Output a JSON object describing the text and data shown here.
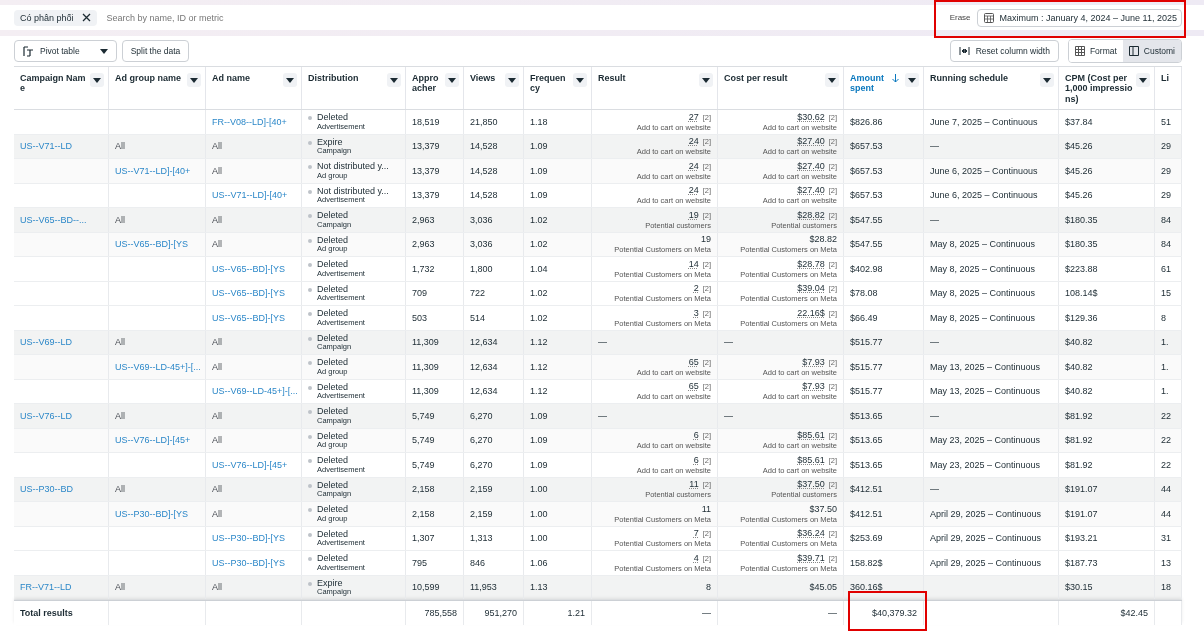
{
  "filter_bar": {
    "chips": [
      {
        "label": "Có phân phối"
      }
    ],
    "search": {
      "placeholder": "Search by name, ID or metric"
    },
    "erase": "Erase",
    "date_range": {
      "label": "Maximum : January 4, 2024 – June 11, 2025",
      "highlighted": true
    }
  },
  "toolbar": {
    "pivot": "Pivot table",
    "split": "Split the data",
    "reset": "Reset column width",
    "view_toggle": [
      {
        "label": "Format",
        "selected": false
      },
      {
        "label": "Customi",
        "selected": true
      }
    ]
  },
  "table": {
    "columns": [
      {
        "label": "Campaign Name",
        "sorted": false
      },
      {
        "label": "Ad group name",
        "sorted": false
      },
      {
        "label": "Ad name",
        "sorted": false
      },
      {
        "label": "Distribution",
        "sorted": false
      },
      {
        "label": "Approacher",
        "sorted": false
      },
      {
        "label": "Views",
        "sorted": false
      },
      {
        "label": "Frequency",
        "sorted": false
      },
      {
        "label": "Result",
        "sorted": false
      },
      {
        "label": "Cost per result",
        "sorted": false
      },
      {
        "label": "Amount spent",
        "sorted": true
      },
      {
        "label": "Running schedule",
        "sorted": false
      },
      {
        "label": "CPM (Cost per 1,000 impressions)",
        "sorted": false
      },
      {
        "label": "Li",
        "sorted": false
      }
    ],
    "rows": [
      {
        "kind": "ad",
        "ad_name": "FR--V08--LD]-[40+",
        "status": "Deleted",
        "status_scope": "Advertisement",
        "reach": "18,519",
        "views": "21,850",
        "frequency": "1.18",
        "result": {
          "value": "27",
          "note": "[2]",
          "label": "Add to cart on website"
        },
        "cost": {
          "value": "$30.62",
          "note": "[2]",
          "label": "Add to cart on website"
        },
        "spent": "$826.86",
        "schedule": "June 7, 2025 – Continuous",
        "cpm": "$37.84",
        "column_13": "51"
      },
      {
        "kind": "campaign",
        "campaign_name": "US--V71--LD",
        "ad_group_name": "All",
        "ad_name": "All",
        "status": "Expire",
        "status_scope": "Campaign",
        "reach": "13,379",
        "views": "14,528",
        "frequency": "1.09",
        "result": {
          "value": "24",
          "note": "[2]",
          "label": "Add to cart on website"
        },
        "cost": {
          "value": "$27.40",
          "note": "[2]",
          "label": "Add to cart on website"
        },
        "spent": "$657.53",
        "schedule": "—",
        "cpm": "$45.26",
        "column_13": "29"
      },
      {
        "kind": "ad_group",
        "ad_group_name": "US--V71--LD]-[40+",
        "ad_name": "All",
        "status": "Not distributed y...",
        "status_scope": "Ad group",
        "reach": "13,379",
        "views": "14,528",
        "frequency": "1.09",
        "result": {
          "value": "24",
          "note": "[2]",
          "label": "Add to cart on website"
        },
        "cost": {
          "value": "$27.40",
          "note": "[2]",
          "label": "Add to cart on website"
        },
        "spent": "$657.53",
        "schedule": "June 6, 2025 – Continuous",
        "cpm": "$45.26",
        "column_13": "29"
      },
      {
        "kind": "ad",
        "ad_name": "US--V71--LD]-[40+",
        "status": "Not distributed y...",
        "status_scope": "Advertisement",
        "reach": "13,379",
        "views": "14,528",
        "frequency": "1.09",
        "result": {
          "value": "24",
          "note": "[2]",
          "label": "Add to cart on website"
        },
        "cost": {
          "value": "$27.40",
          "note": "[2]",
          "label": "Add to cart on website"
        },
        "spent": "$657.53",
        "schedule": "June 6, 2025 – Continuous",
        "cpm": "$45.26",
        "column_13": "29"
      },
      {
        "kind": "campaign",
        "campaign_name": "US--V65--BD--...",
        "ad_group_name": "All",
        "ad_name": "All",
        "status": "Deleted",
        "status_scope": "Campaign",
        "reach": "2,963",
        "views": "3,036",
        "frequency": "1.02",
        "result": {
          "value": "19",
          "note": "[2]",
          "label": "Potential customers"
        },
        "cost": {
          "value": "$28.82",
          "note": "[2]",
          "label": "Potential customers"
        },
        "spent": "$547.55",
        "schedule": "—",
        "cpm": "$180.35",
        "column_13": "84"
      },
      {
        "kind": "ad_group",
        "ad_group_name": "US--V65--BD]-[YS",
        "ad_name": "All",
        "status": "Deleted",
        "status_scope": "Ad group",
        "reach": "2,963",
        "views": "3,036",
        "frequency": "1.02",
        "result": {
          "value": "19",
          "label": "Potential Customers on Meta"
        },
        "cost": {
          "value": "$28.82",
          "label": "Potential Customers on Meta"
        },
        "spent": "$547.55",
        "schedule": "May 8, 2025 – Continuous",
        "cpm": "$180.35",
        "column_13": "84"
      },
      {
        "kind": "ad",
        "ad_name": "US--V65--BD]-[YS",
        "status": "Deleted",
        "status_scope": "Advertisement",
        "reach": "1,732",
        "views": "1,800",
        "frequency": "1.04",
        "result": {
          "value": "14",
          "note": "[2]",
          "label": "Potential Customers on Meta"
        },
        "cost": {
          "value": "$28.78",
          "note": "[2]",
          "label": "Potential Customers on Meta"
        },
        "spent": "$402.98",
        "schedule": "May 8, 2025 – Continuous",
        "cpm": "$223.88",
        "column_13": "61"
      },
      {
        "kind": "ad",
        "ad_name": "US--V65--BD]-[YS",
        "status": "Deleted",
        "status_scope": "Advertisement",
        "reach": "709",
        "views": "722",
        "frequency": "1.02",
        "result": {
          "value": "2",
          "note": "[2]",
          "label": "Potential Customers on Meta"
        },
        "cost": {
          "value": "$39.04",
          "note": "[2]",
          "label": "Potential Customers on Meta"
        },
        "spent": "$78.08",
        "schedule": "May 8, 2025 – Continuous",
        "cpm": "108.14$",
        "column_13": "15"
      },
      {
        "kind": "ad",
        "ad_name": "US--V65--BD]-[YS",
        "status": "Deleted",
        "status_scope": "Advertisement",
        "reach": "503",
        "views": "514",
        "frequency": "1.02",
        "result": {
          "value": "3",
          "note": "[2]",
          "label": "Potential Customers on Meta"
        },
        "cost": {
          "value": "22.16$",
          "note": "[2]",
          "label": "Potential Customers on Meta"
        },
        "spent": "$66.49",
        "schedule": "May 8, 2025 – Continuous",
        "cpm": "$129.36",
        "column_13": "8"
      },
      {
        "kind": "campaign",
        "campaign_name": "US--V69--LD",
        "ad_group_name": "All",
        "ad_name": "All",
        "status": "Deleted",
        "status_scope": "Campaign",
        "reach": "11,309",
        "views": "12,634",
        "frequency": "1.12",
        "result": {
          "value": "—"
        },
        "cost": {
          "value": "—"
        },
        "spent": "$515.77",
        "schedule": "—",
        "cpm": "$40.82",
        "column_13": "1."
      },
      {
        "kind": "ad_group",
        "ad_group_name": "US--V69--LD-45+]-[...",
        "ad_name": "All",
        "status": "Deleted",
        "status_scope": "Ad group",
        "reach": "11,309",
        "views": "12,634",
        "frequency": "1.12",
        "result": {
          "value": "65",
          "note": "[2]",
          "label": "Add to cart on website"
        },
        "cost": {
          "value": "$7.93",
          "note": "[2]",
          "label": "Add to cart on website"
        },
        "spent": "$515.77",
        "schedule": "May 13, 2025 – Continuous",
        "cpm": "$40.82",
        "column_13": "1."
      },
      {
        "kind": "ad",
        "ad_name": "US--V69--LD-45+]-[...",
        "status": "Deleted",
        "status_scope": "Advertisement",
        "reach": "11,309",
        "views": "12,634",
        "frequency": "1.12",
        "result": {
          "value": "65",
          "note": "[2]",
          "label": "Add to cart on website"
        },
        "cost": {
          "value": "$7.93",
          "note": "[2]",
          "label": "Add to cart on website"
        },
        "spent": "$515.77",
        "schedule": "May 13, 2025 – Continuous",
        "cpm": "$40.82",
        "column_13": "1."
      },
      {
        "kind": "campaign",
        "campaign_name": "US--V76--LD",
        "ad_group_name": "All",
        "ad_name": "All",
        "status": "Deleted",
        "status_scope": "Campaign",
        "reach": "5,749",
        "views": "6,270",
        "frequency": "1.09",
        "result": {
          "value": "—"
        },
        "cost": {
          "value": "—"
        },
        "spent": "$513.65",
        "schedule": "—",
        "cpm": "$81.92",
        "column_13": "22"
      },
      {
        "kind": "ad_group",
        "ad_group_name": "US--V76--LD]-[45+",
        "ad_name": "All",
        "status": "Deleted",
        "status_scope": "Ad group",
        "reach": "5,749",
        "views": "6,270",
        "frequency": "1.09",
        "result": {
          "value": "6",
          "note": "[2]",
          "label": "Add to cart on website"
        },
        "cost": {
          "value": "$85.61",
          "note": "[2]",
          "label": "Add to cart on website"
        },
        "spent": "$513.65",
        "schedule": "May 23, 2025 – Continuous",
        "cpm": "$81.92",
        "column_13": "22"
      },
      {
        "kind": "ad",
        "ad_name": "US--V76--LD]-[45+",
        "status": "Deleted",
        "status_scope": "Advertisement",
        "reach": "5,749",
        "views": "6,270",
        "frequency": "1.09",
        "result": {
          "value": "6",
          "note": "[2]",
          "label": "Add to cart on website"
        },
        "cost": {
          "value": "$85.61",
          "note": "[2]",
          "label": "Add to cart on website"
        },
        "spent": "$513.65",
        "schedule": "May 23, 2025 – Continuous",
        "cpm": "$81.92",
        "column_13": "22"
      },
      {
        "kind": "campaign",
        "campaign_name": "US--P30--BD",
        "ad_group_name": "All",
        "ad_name": "All",
        "status": "Deleted",
        "status_scope": "Campaign",
        "reach": "2,158",
        "views": "2,159",
        "frequency": "1.00",
        "result": {
          "value": "11",
          "note": "[2]",
          "label": "Potential customers"
        },
        "cost": {
          "value": "$37.50",
          "note": "[2]",
          "label": "Potential customers"
        },
        "spent": "$412.51",
        "schedule": "—",
        "cpm": "$191.07",
        "column_13": "44"
      },
      {
        "kind": "ad_group",
        "ad_group_name": "US--P30--BD]-[YS",
        "ad_name": "All",
        "status": "Deleted",
        "status_scope": "Ad group",
        "reach": "2,158",
        "views": "2,159",
        "frequency": "1.00",
        "result": {
          "value": "11",
          "label": "Potential Customers on Meta"
        },
        "cost": {
          "value": "$37.50",
          "label": "Potential Customers on Meta"
        },
        "spent": "$412.51",
        "schedule": "April 29, 2025 – Continuous",
        "cpm": "$191.07",
        "column_13": "44"
      },
      {
        "kind": "ad",
        "ad_name": "US--P30--BD]-[YS",
        "status": "Deleted",
        "status_scope": "Advertisement",
        "reach": "1,307",
        "views": "1,313",
        "frequency": "1.00",
        "result": {
          "value": "7",
          "note": "[2]",
          "label": "Potential Customers on Meta"
        },
        "cost": {
          "value": "$36.24",
          "note": "[2]",
          "label": "Potential Customers on Meta"
        },
        "spent": "$253.69",
        "schedule": "April 29, 2025 – Continuous",
        "cpm": "$193.21",
        "column_13": "31"
      },
      {
        "kind": "ad",
        "ad_name": "US--P30--BD]-[YS",
        "status": "Deleted",
        "status_scope": "Advertisement",
        "reach": "795",
        "views": "846",
        "frequency": "1.06",
        "result": {
          "value": "4",
          "note": "[2]",
          "label": "Potential Customers on Meta"
        },
        "cost": {
          "value": "$39.71",
          "note": "[2]",
          "label": "Potential Customers on Meta"
        },
        "spent": "158.82$",
        "schedule": "April 29, 2025 – Continuous",
        "cpm": "$187.73",
        "column_13": "13"
      },
      {
        "kind": "campaign",
        "campaign_name": "FR--V71--LD",
        "ad_group_name": "All",
        "ad_name": "All",
        "status": "Expire",
        "status_scope": "Campaign",
        "reach": "10,599",
        "views": "11,953",
        "frequency": "1.13",
        "result": {
          "value": "8"
        },
        "cost": {
          "value": "$45.05"
        },
        "spent": "360.16$",
        "cpm": "$30.15",
        "column_13": "18"
      }
    ],
    "totals": {
      "label": "Total results",
      "reach": "785,558",
      "views": "951,270",
      "frequency": "1.21",
      "result": "—",
      "cost": "—",
      "spent": {
        "value": "$40,379.32",
        "highlighted": true
      },
      "cpm": "$42.45"
    }
  }
}
